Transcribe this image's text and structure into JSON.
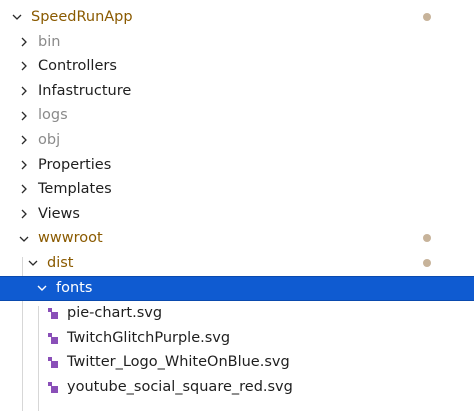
{
  "colors": {
    "modified_text": "#8a5a00",
    "muted_text": "#8a8a8a",
    "selection_bg": "#0f5bd1",
    "modified_dot": "#c7b39a",
    "svg_icon": "#8a4fb8"
  },
  "tree": {
    "root": {
      "label": "SpeedRunApp",
      "expanded": true,
      "modified": true,
      "icon": "chevron-down-icon"
    },
    "items": [
      {
        "label": "bin",
        "icon": "chevron-right-icon",
        "muted": true
      },
      {
        "label": "Controllers",
        "icon": "chevron-right-icon"
      },
      {
        "label": "Infastructure",
        "icon": "chevron-right-icon"
      },
      {
        "label": "logs",
        "icon": "chevron-right-icon",
        "muted": true
      },
      {
        "label": "obj",
        "icon": "chevron-right-icon",
        "muted": true
      },
      {
        "label": "Properties",
        "icon": "chevron-right-icon"
      },
      {
        "label": "Templates",
        "icon": "chevron-right-icon"
      },
      {
        "label": "Views",
        "icon": "chevron-right-icon"
      },
      {
        "label": "wwwroot",
        "icon": "chevron-down-icon",
        "modified": true
      },
      {
        "label": "dist",
        "icon": "chevron-down-icon",
        "modified": true
      },
      {
        "label": "fonts",
        "icon": "chevron-down-icon",
        "selected": true
      }
    ],
    "files": [
      {
        "label": "pie-chart.svg",
        "icon": "svg-file-icon"
      },
      {
        "label": "TwitchGlitchPurple.svg",
        "icon": "svg-file-icon"
      },
      {
        "label": "Twitter_Logo_WhiteOnBlue.svg",
        "icon": "svg-file-icon"
      },
      {
        "label": "youtube_social_square_red.svg",
        "icon": "svg-file-icon"
      }
    ]
  }
}
